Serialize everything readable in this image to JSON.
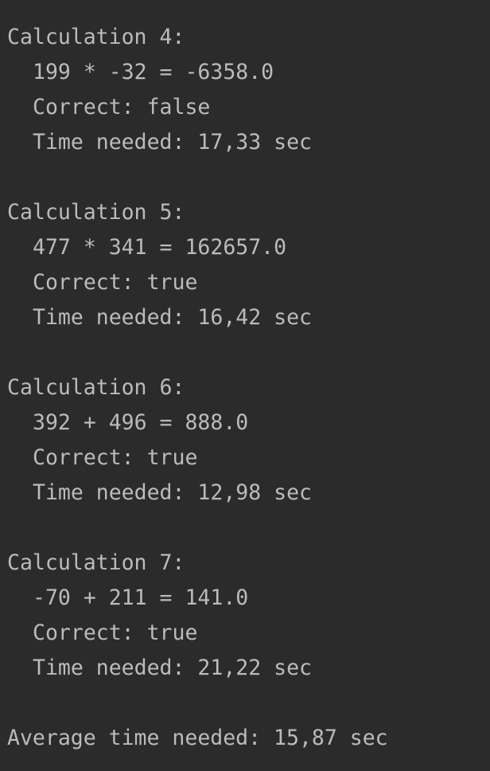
{
  "console": {
    "calculations": [
      {
        "header": "Calculation 4:",
        "expression": "199 * -32 = -6358.0",
        "correct": "Correct: false",
        "time": "Time needed: 17,33 sec"
      },
      {
        "header": "Calculation 5:",
        "expression": "477 * 341 = 162657.0",
        "correct": "Correct: true",
        "time": "Time needed: 16,42 sec"
      },
      {
        "header": "Calculation 6:",
        "expression": "392 + 496 = 888.0",
        "correct": "Correct: true",
        "time": "Time needed: 12,98 sec"
      },
      {
        "header": "Calculation 7:",
        "expression": "-70 + 211 = 141.0",
        "correct": "Correct: true",
        "time": "Time needed: 21,22 sec"
      }
    ],
    "average": "Average time needed: 15,87 sec"
  }
}
